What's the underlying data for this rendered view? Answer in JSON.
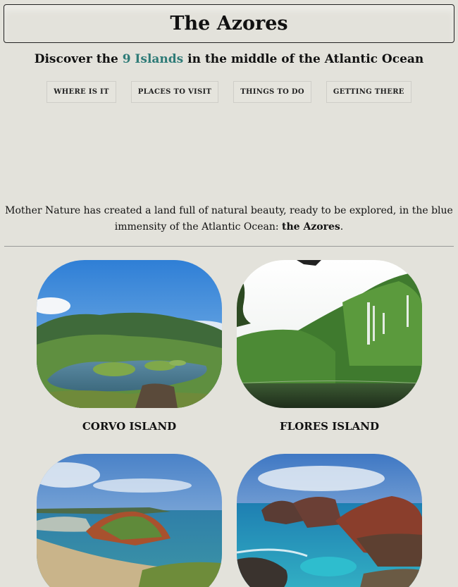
{
  "header": {
    "title": "The Azores",
    "subtitle_before": "Discover the ",
    "subtitle_accent": "9 Islands",
    "subtitle_after": " in the middle of the Atlantic Ocean",
    "accent_color": "#2e7b77"
  },
  "nav": {
    "items": [
      {
        "label": "Where is it"
      },
      {
        "label": "Places to visit"
      },
      {
        "label": "Things to do"
      },
      {
        "label": "Getting there"
      }
    ]
  },
  "intro": {
    "text_before": "Mother Nature has created a land full of natural beauty, ready to be explored, in the blue immensity of the Atlantic Ocean: ",
    "text_bold": "the Azores",
    "text_after": "."
  },
  "islands": [
    {
      "name": "Corvo Island",
      "image": "crater-lake-photo"
    },
    {
      "name": "Flores Island",
      "image": "waterfalls-photo"
    },
    {
      "name": "",
      "image": "coastal-bay-photo"
    },
    {
      "name": "",
      "image": "rocky-coast-photo"
    }
  ],
  "colors": {
    "background": "#e3e2db",
    "text": "#111111"
  }
}
